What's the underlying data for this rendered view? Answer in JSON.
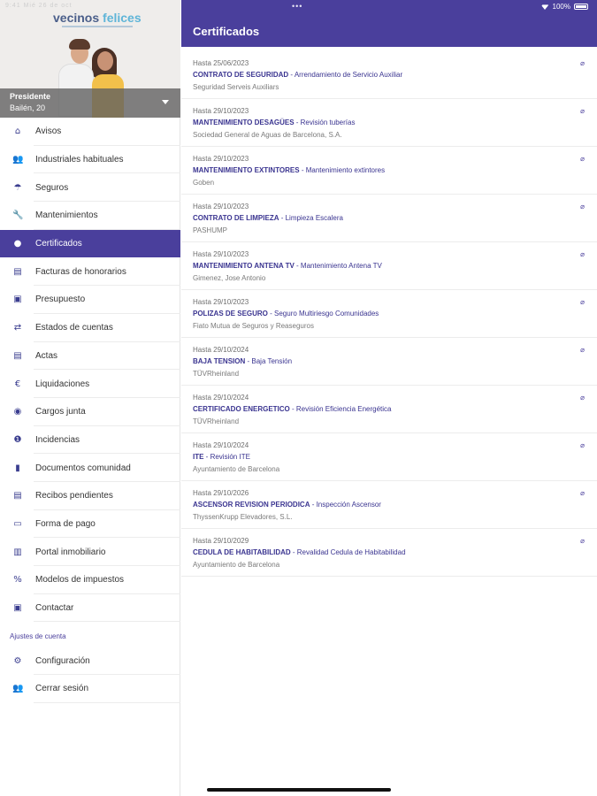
{
  "status_bar": {
    "left": "9:41  Mié 26 de oct",
    "dots": "•••",
    "battery": "100%"
  },
  "sidebar": {
    "brand_main": "vecinos",
    "brand_accent": " felices",
    "role": "Presidente",
    "address": "Bailén, 20",
    "items": [
      {
        "label": "Avisos",
        "icon": "⌂"
      },
      {
        "label": "Industriales habituales",
        "icon": "👥"
      },
      {
        "label": "Seguros",
        "icon": "☂"
      },
      {
        "label": "Mantenimientos",
        "icon": "🔧"
      },
      {
        "label": "Certificados",
        "icon": "●"
      },
      {
        "label": "Facturas de honorarios",
        "icon": "▤"
      },
      {
        "label": "Presupuesto",
        "icon": "▣"
      },
      {
        "label": "Estados de cuentas",
        "icon": "⇄"
      },
      {
        "label": "Actas",
        "icon": "▤"
      },
      {
        "label": "Liquidaciones",
        "icon": "€"
      },
      {
        "label": "Cargos junta",
        "icon": "◉"
      },
      {
        "label": "Incidencias",
        "icon": "❶"
      },
      {
        "label": "Documentos comunidad",
        "icon": "▮"
      },
      {
        "label": "Recibos pendientes",
        "icon": "▤"
      },
      {
        "label": "Forma de pago",
        "icon": "▭"
      },
      {
        "label": "Portal inmobiliario",
        "icon": "▥"
      },
      {
        "label": "Modelos de impuestos",
        "icon": "%"
      },
      {
        "label": "Contactar",
        "icon": "▣"
      }
    ],
    "account_section": "Ajustes de cuenta",
    "account_items": [
      {
        "label": "Configuración",
        "icon": "⚙"
      },
      {
        "label": "Cerrar sesión",
        "icon": "👥"
      }
    ]
  },
  "header": {
    "title": "Certificados"
  },
  "certificates": [
    {
      "date": "Hasta 25/06/2023",
      "name": "CONTRATO DE SEGURIDAD",
      "desc": " - Arrendamiento de Servicio Auxiliar",
      "company": "Seguridad Serveis Auxiliars"
    },
    {
      "date": "Hasta 29/10/2023",
      "name": "MANTENIMIENTO DESAGÜES",
      "desc": " - Revisión tuberías",
      "company": "Sociedad General de Aguas de Barcelona, S.A."
    },
    {
      "date": "Hasta 29/10/2023",
      "name": "MANTENIMIENTO EXTINTORES",
      "desc": " - Mantenimiento extintores",
      "company": "Goben"
    },
    {
      "date": "Hasta 29/10/2023",
      "name": "CONTRATO DE LIMPIEZA",
      "desc": " - Limpieza Escalera",
      "company": "PASHUMP"
    },
    {
      "date": "Hasta 29/10/2023",
      "name": "MANTENIMIENTO ANTENA TV",
      "desc": " - Mantenimiento Antena TV",
      "company": "Gimenez, Jose Antonio"
    },
    {
      "date": "Hasta 29/10/2023",
      "name": "POLIZAS DE SEGURO",
      "desc": " - Seguro Multiriesgo Comunidades",
      "company": "Fiato Mutua de Seguros y Reaseguros"
    },
    {
      "date": "Hasta 29/10/2024",
      "name": "BAJA TENSION",
      "desc": " - Baja Tensión",
      "company": "TÜVRheinland"
    },
    {
      "date": "Hasta 29/10/2024",
      "name": "CERTIFICADO ENERGETICO",
      "desc": " - Revisión Eficiencia Energética",
      "company": "TÜVRheinland"
    },
    {
      "date": "Hasta 29/10/2024",
      "name": "ITE",
      "desc": " - Revisión ITE",
      "company": "Ayuntamiento de Barcelona"
    },
    {
      "date": "Hasta 29/10/2026",
      "name": "ASCENSOR REVISION PERIODICA",
      "desc": " - Inspección Ascensor",
      "company": "ThyssenKrupp Elevadores, S.L."
    },
    {
      "date": "Hasta 29/10/2029",
      "name": "CEDULA DE HABITABILIDAD",
      "desc": " - Revalidad Cedula de Habitabilidad",
      "company": "Ayuntamiento de Barcelona"
    }
  ],
  "colors": {
    "accent": "#4a3f9c",
    "link": "#3a3490"
  }
}
